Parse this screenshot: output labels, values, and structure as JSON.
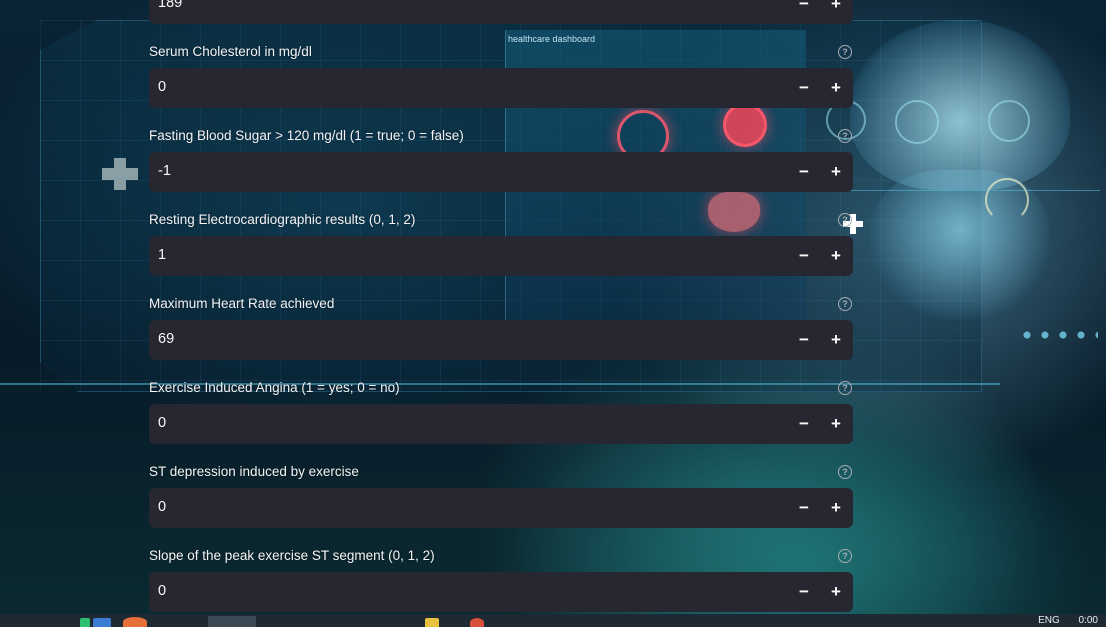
{
  "background": {
    "dashboard_title": "healthcare dashboard"
  },
  "form": {
    "fields": [
      {
        "label": "",
        "value": "189"
      },
      {
        "label": "Serum Cholesterol in mg/dl",
        "value": "0"
      },
      {
        "label": "Fasting Blood Sugar > 120 mg/dl (1 = true; 0 = false)",
        "value": "-1"
      },
      {
        "label": "Resting Electrocardiographic results (0, 1, 2)",
        "value": "1"
      },
      {
        "label": "Maximum Heart Rate achieved",
        "value": "69"
      },
      {
        "label": "Exercise Induced Angina (1 = yes; 0 = no)",
        "value": "0"
      },
      {
        "label": "ST depression induced by exercise",
        "value": "0"
      },
      {
        "label": "Slope of the peak exercise ST segment (0, 1, 2)",
        "value": "0"
      }
    ],
    "minus_symbol": "−",
    "plus_symbol": "+",
    "help_symbol": "?"
  },
  "taskbar": {
    "language": "ENG",
    "time": "0:00"
  }
}
